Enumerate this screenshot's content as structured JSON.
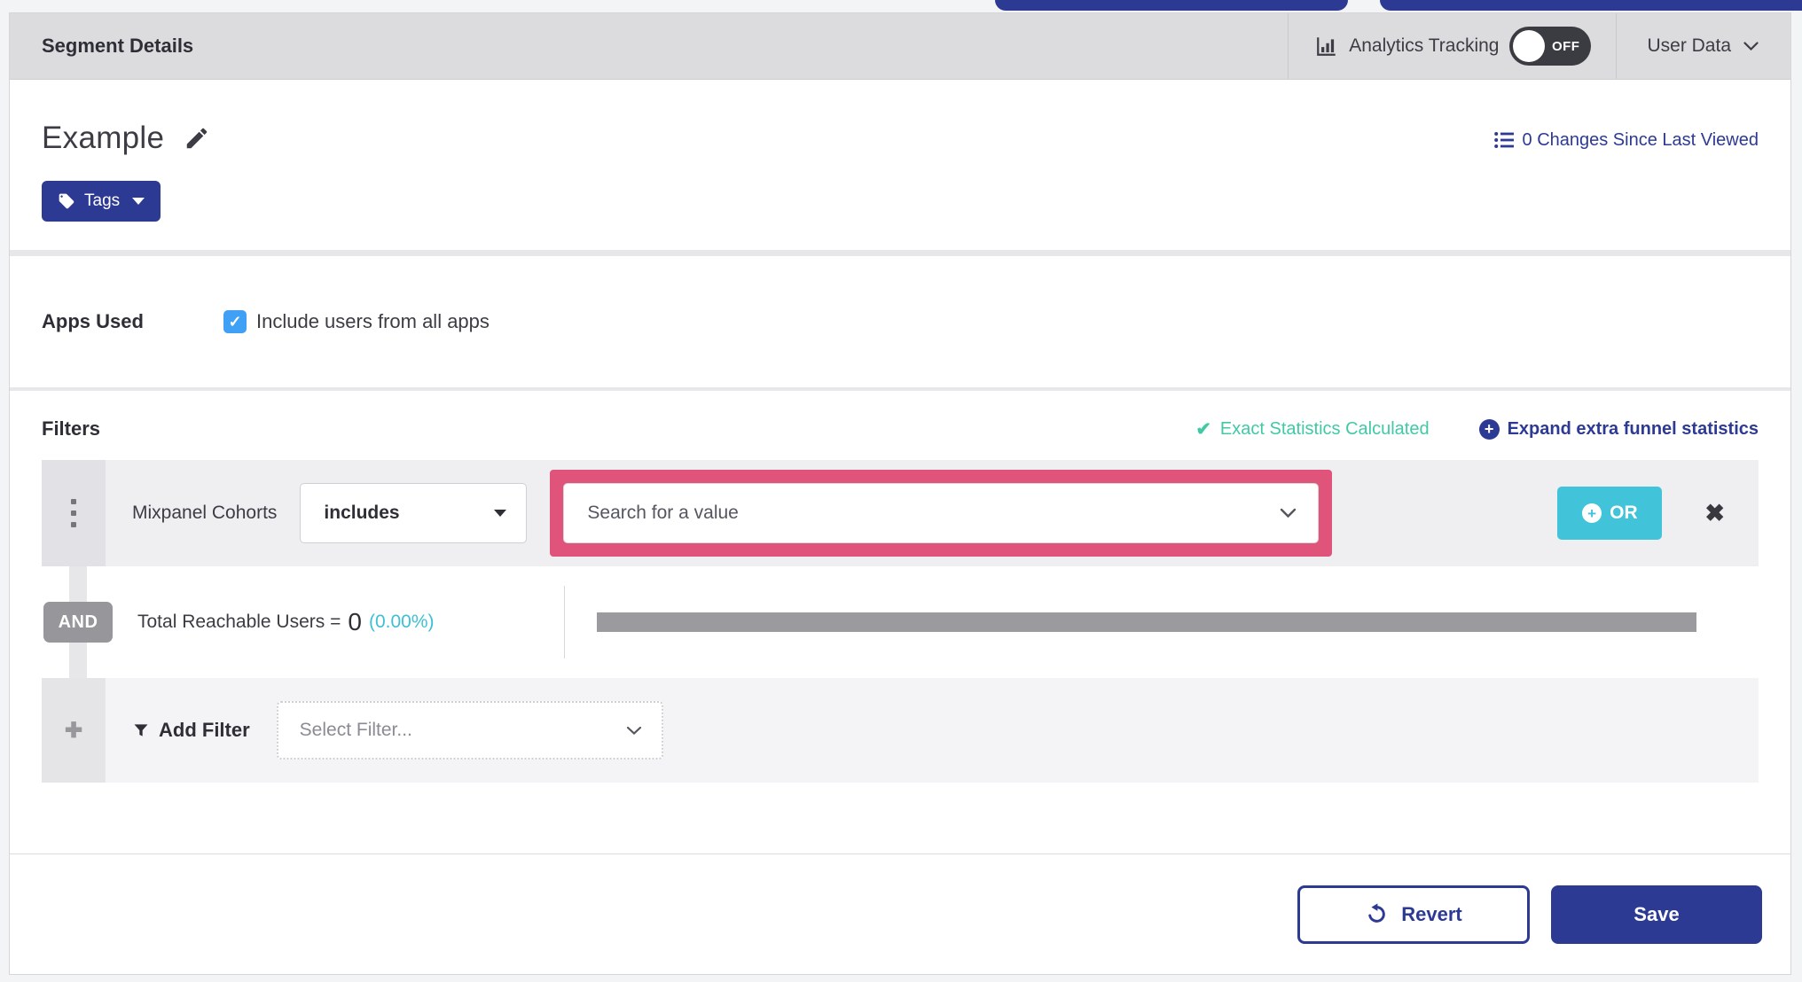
{
  "colors": {
    "brand_blue": "#2d3a94",
    "teal_success": "#41c9a5",
    "cyan_accent": "#41c4d9",
    "highlight_pink": "#e0537b",
    "checkbox_blue": "#3fa0f5",
    "header_gray": "#dcdcdf",
    "row_gray": "#efeff2",
    "and_badge_gray": "#96969b",
    "bar_gray": "#9b9b9f"
  },
  "header": {
    "title": "Segment Details",
    "analytics_tracking_label": "Analytics Tracking",
    "toggle_state": "OFF",
    "user_data_label": "User Data"
  },
  "segment": {
    "name": "Example",
    "tags_label": "Tags",
    "changes_link": "0 Changes Since Last Viewed"
  },
  "apps_used": {
    "label": "Apps Used",
    "checkbox_checked": true,
    "checkbox_mark": "✓",
    "checkbox_label": "Include users from all apps"
  },
  "filters": {
    "title": "Filters",
    "exact_stats_check": "✔",
    "exact_stats_label": "Exact Statistics Calculated",
    "expand_plus": "+",
    "expand_link_label": "Expand extra funnel statistics",
    "filter_row": {
      "field": "Mixpanel Cohorts",
      "operator": "includes",
      "value_placeholder": "Search for a value",
      "or_plus": "+",
      "or_label": "OR",
      "remove_glyph": "✖"
    },
    "and_label": "AND",
    "reachable": {
      "label": "Total Reachable Users =",
      "value": "0",
      "percent": "(0.00%)"
    },
    "add_row": {
      "plus_glyph": "✚",
      "add_filter_label": "Add Filter",
      "select_placeholder": "Select Filter..."
    }
  },
  "footer": {
    "revert_label": "Revert",
    "save_label": "Save"
  }
}
